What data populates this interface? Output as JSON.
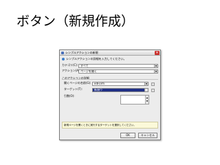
{
  "slide": {
    "title": "ボタン（新規作成）"
  },
  "dialog": {
    "title": "シンプルアクションの新規",
    "info_text": "シンプルアクションの詳細を入力してください。",
    "category": {
      "label": "カテゴリ(C):",
      "value": "すべて"
    },
    "action": {
      "label": "アクション(A):",
      "value": "ページを開く"
    },
    "details_heading": "このアクションの詳細",
    "page_to_open": {
      "label": "開くページの名前(G):",
      "value": "edForm"
    },
    "target_frame": {
      "label": "ターゲット(T):",
      "value": "新規ウ"
    },
    "options": {
      "label": "引数(O):"
    },
    "description": "新規ページを開くときに実行するターゲットを選択してください。",
    "ok_label": "OK",
    "cancel_label": "キャンセル"
  }
}
